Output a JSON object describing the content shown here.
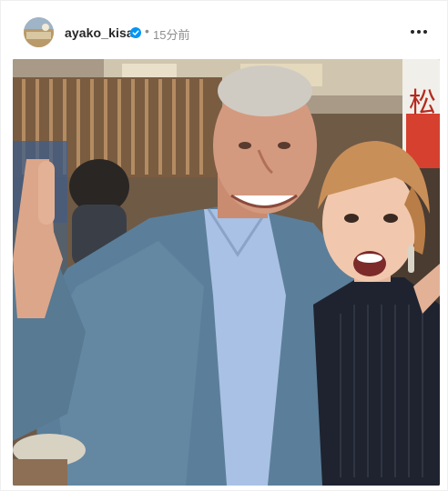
{
  "post": {
    "username": "ayako_kisa",
    "verified_icon": "verified-badge-icon",
    "separator": "•",
    "timestamp": "15分前",
    "more_icon": "more-options-icon"
  },
  "photo": {
    "sign_text": "松",
    "colors": {
      "jacket": "#5b7f9a",
      "shirt": "#a9c1e4",
      "blouse": "#1f2330",
      "sign": "#d5402f",
      "verified": "#0095f6"
    }
  }
}
